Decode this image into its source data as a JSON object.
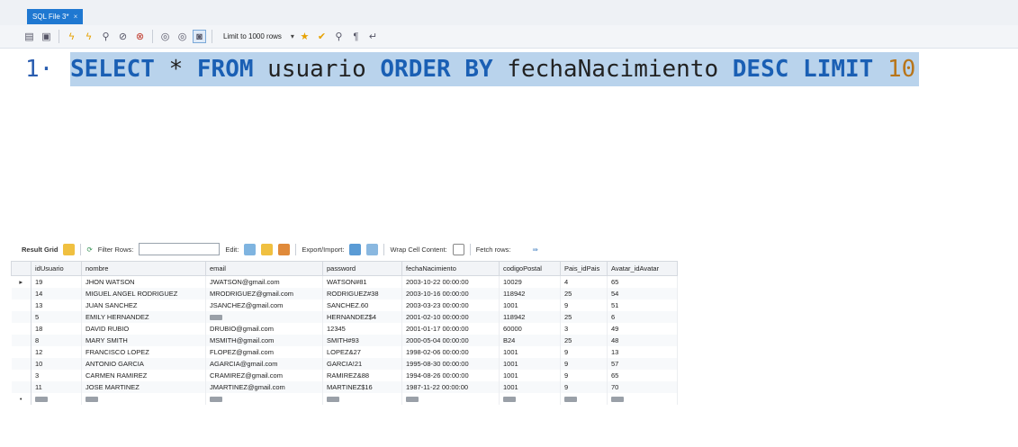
{
  "tab": {
    "title": "SQL File 3*",
    "close": "×"
  },
  "toolbar": {
    "limit_label": "Limit to 1000 rows"
  },
  "editor": {
    "line_number": "1",
    "tokens": {
      "select": "SELECT",
      "star": " * ",
      "from": "FROM",
      "table": " usuario ",
      "order": "ORDER",
      "by": " BY",
      "field": " fechaNacimiento ",
      "desc": "DESC",
      "limit": " LIMIT ",
      "count": "10"
    }
  },
  "result_toolbar": {
    "grid": "Result Grid",
    "filter": "Filter Rows:",
    "edit": "Edit:",
    "export": "Export/Import:",
    "wrap": "Wrap Cell Content:",
    "fetch": "Fetch rows:"
  },
  "grid": {
    "columns": [
      "idUsuario",
      "nombre",
      "email",
      "password",
      "fechaNacimiento",
      "codigoPostal",
      "Pais_idPais",
      "Avatar_idAvatar"
    ],
    "rows": [
      [
        "19",
        "JHON WATSON",
        "JWATSON@gmail.com",
        "WATSON#81",
        "2003-10-22 00:00:00",
        "10029",
        "4",
        "65"
      ],
      [
        "14",
        "MIGUEL ANGEL RODRIGUEZ",
        "MRODRIGUEZ@gmail.com",
        "RODRIGUEZ#38",
        "2003-10-16 00:00:00",
        "118942",
        "25",
        "54"
      ],
      [
        "13",
        "JUAN SANCHEZ",
        "JSANCHEZ@gmail.com",
        "SANCHEZ.60",
        "2003-03-23 00:00:00",
        "1001",
        "9",
        "51"
      ],
      [
        "5",
        "EMILY HERNANDEZ",
        "",
        "HERNANDEZ$4",
        "2001-02-10 00:00:00",
        "118942",
        "25",
        "6"
      ],
      [
        "18",
        "DAVID RUBIO",
        "DRUBIO@gmail.com",
        "12345",
        "2001-01-17 00:00:00",
        "60000",
        "3",
        "49"
      ],
      [
        "8",
        "MARY SMITH",
        "MSMITH@gmail.com",
        "SMITH#93",
        "2000-05-04 00:00:00",
        "B24",
        "25",
        "48"
      ],
      [
        "12",
        "FRANCISCO LOPEZ",
        "FLOPEZ@gmail.com",
        "LOPEZ&27",
        "1998-02-06 00:00:00",
        "1001",
        "9",
        "13"
      ],
      [
        "10",
        "ANTONIO GARCIA",
        "AGARCIA@gmail.com",
        "GARCIA!21",
        "1995-08-30 00:00:00",
        "1001",
        "9",
        "57"
      ],
      [
        "3",
        "CARMEN RAMIREZ",
        "CRAMIREZ@gmail.com",
        "RAMIREZ&88",
        "1994-08-26 00:00:00",
        "1001",
        "9",
        "65"
      ],
      [
        "11",
        "JOSE MARTINEZ",
        "JMARTINEZ@gmail.com",
        "MARTINEZ$16",
        "1987-11-22 00:00:00",
        "1001",
        "9",
        "70"
      ]
    ],
    "null_rows": {
      "3": [
        2
      ]
    }
  }
}
